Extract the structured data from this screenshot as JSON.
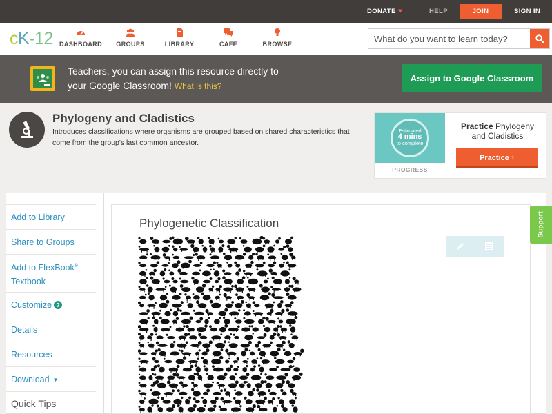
{
  "topbar": {
    "donate": "DONATE",
    "help": "HELP",
    "join": "JOIN",
    "signin": "SIGN IN"
  },
  "logo": {
    "c": "c",
    "k": "K",
    "n": "-12"
  },
  "nav": {
    "items": [
      {
        "label": "DASHBOARD",
        "icon": "dashboard-icon"
      },
      {
        "label": "GROUPS",
        "icon": "groups-icon"
      },
      {
        "label": "LIBRARY",
        "icon": "library-icon"
      },
      {
        "label": "CAFE",
        "icon": "cafe-icon"
      },
      {
        "label": "BROWSE",
        "icon": "browse-icon"
      }
    ]
  },
  "search": {
    "placeholder": "What do you want to learn today?"
  },
  "classroom": {
    "line1": "Teachers, you can assign this resource directly to",
    "line2": "your Google Classroom!",
    "what": "What is this?",
    "assign": "Assign to Google Classroom"
  },
  "header": {
    "title": "Phylogeny and Cladistics",
    "description": "Introduces classifications where organisms are grouped based on shared characteristics that come from the group's last common ancestor."
  },
  "practice": {
    "estimated": "Estimated",
    "mins": "4 mins",
    "complete": "to complete",
    "progress": "PROGRESS",
    "title_bold": "Practice",
    "title_rest": " Phylogeny and Cladistics",
    "button": "Practice"
  },
  "sidebar": {
    "add_library": "Add to Library",
    "share": "Share to Groups",
    "flexbook_1": "Add to FlexBook",
    "flexbook_reg": "®",
    "flexbook_2": "Textbook",
    "customize": "Customize",
    "details": "Details",
    "resources": "Resources",
    "download": "Download",
    "quick_tips": "Quick Tips"
  },
  "content": {
    "title": "Phylogenetic Classification"
  },
  "support": "Support",
  "colors": {
    "accent": "#ee5e31",
    "green": "#1e9b55",
    "link": "#2a8fc0",
    "support": "#7bc94a"
  }
}
